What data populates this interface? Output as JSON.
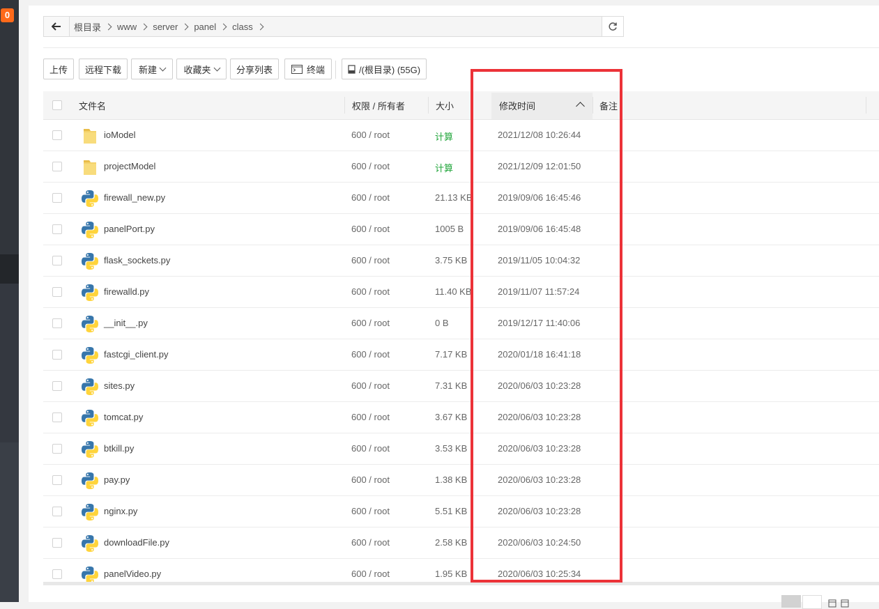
{
  "notification_badge": "0",
  "breadcrumb": [
    "根目录",
    "www",
    "server",
    "panel",
    "class"
  ],
  "toolbar": {
    "upload": "上传",
    "remote_download": "远程下载",
    "new": "新建",
    "favorites": "收藏夹",
    "share_list": "分享列表",
    "terminal": "终端",
    "disk": "/(根目录) (55G)"
  },
  "columns": {
    "name": "文件名",
    "permission": "权限 / 所有者",
    "size": "大小",
    "mtime": "修改时间",
    "note": "备注"
  },
  "sort": {
    "column": "mtime",
    "direction": "ascending"
  },
  "colors": {
    "calc_text": "#20a53a",
    "highlight_box": "#ec3238",
    "badge": "#ff6a1a"
  },
  "files": [
    {
      "name": "ioModel",
      "type": "folder",
      "perm": "600 / root",
      "size": "计算",
      "mtime": "2021/12/08 10:26:44"
    },
    {
      "name": "projectModel",
      "type": "folder",
      "perm": "600 / root",
      "size": "计算",
      "mtime": "2021/12/09 12:01:50"
    },
    {
      "name": "firewall_new.py",
      "type": "python",
      "perm": "600 / root",
      "size": "21.13 KB",
      "mtime": "2019/09/06 16:45:46"
    },
    {
      "name": "panelPort.py",
      "type": "python",
      "perm": "600 / root",
      "size": "1005 B",
      "mtime": "2019/09/06 16:45:48"
    },
    {
      "name": "flask_sockets.py",
      "type": "python",
      "perm": "600 / root",
      "size": "3.75 KB",
      "mtime": "2019/11/05 10:04:32"
    },
    {
      "name": "firewalld.py",
      "type": "python",
      "perm": "600 / root",
      "size": "11.40 KB",
      "mtime": "2019/11/07 11:57:24"
    },
    {
      "name": "__init__.py",
      "type": "python",
      "perm": "600 / root",
      "size": "0 B",
      "mtime": "2019/12/17 11:40:06"
    },
    {
      "name": "fastcgi_client.py",
      "type": "python",
      "perm": "600 / root",
      "size": "7.17 KB",
      "mtime": "2020/01/18 16:41:18"
    },
    {
      "name": "sites.py",
      "type": "python",
      "perm": "600 / root",
      "size": "7.31 KB",
      "mtime": "2020/06/03 10:23:28"
    },
    {
      "name": "tomcat.py",
      "type": "python",
      "perm": "600 / root",
      "size": "3.67 KB",
      "mtime": "2020/06/03 10:23:28"
    },
    {
      "name": "btkill.py",
      "type": "python",
      "perm": "600 / root",
      "size": "3.53 KB",
      "mtime": "2020/06/03 10:23:28"
    },
    {
      "name": "pay.py",
      "type": "python",
      "perm": "600 / root",
      "size": "1.38 KB",
      "mtime": "2020/06/03 10:23:28"
    },
    {
      "name": "nginx.py",
      "type": "python",
      "perm": "600 / root",
      "size": "5.51 KB",
      "mtime": "2020/06/03 10:23:28"
    },
    {
      "name": "downloadFile.py",
      "type": "python",
      "perm": "600 / root",
      "size": "2.58 KB",
      "mtime": "2020/06/03 10:24:50"
    },
    {
      "name": "panelVideo.py",
      "type": "python",
      "perm": "600 / root",
      "size": "1.95 KB",
      "mtime": "2020/06/03 10:25:34"
    }
  ]
}
